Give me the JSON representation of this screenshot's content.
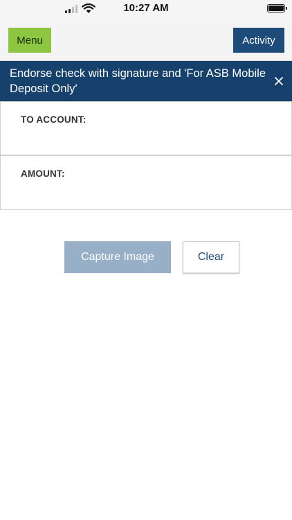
{
  "status_bar": {
    "time": "10:27 AM",
    "icons": [
      "cellular-signal-icon",
      "wifi-icon",
      "battery-icon"
    ]
  },
  "header": {
    "menu_label": "Menu",
    "activity_label": "Activity"
  },
  "banner": {
    "message": "Endorse check with signature and 'For ASB Mobile Deposit Only'",
    "close_icon": "close-icon"
  },
  "form": {
    "to_account_label": "TO ACCOUNT:",
    "amount_label": "AMOUNT:"
  },
  "actions": {
    "capture_label": "Capture Image",
    "clear_label": "Clear"
  },
  "colors": {
    "menu_green": "#8dc641",
    "activity_blue": "#1e4c7a",
    "banner_navy": "#16416d",
    "capture_disabled": "#97b0c7"
  }
}
